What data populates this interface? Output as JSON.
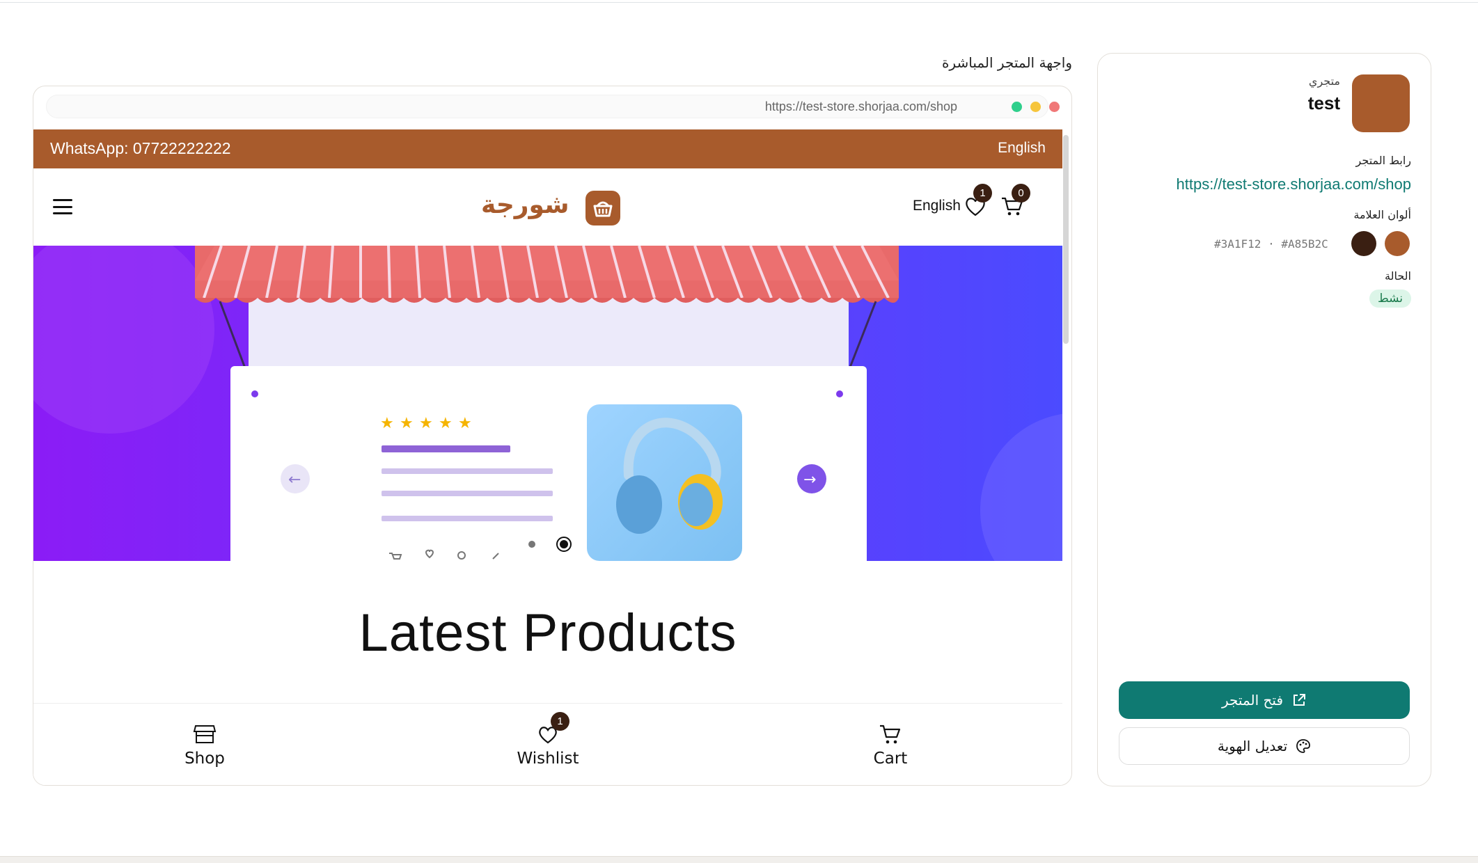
{
  "preview": {
    "title": "واجهة المتجر المباشرة",
    "address_url": "https://test-store.shorjaa.com/shop"
  },
  "site": {
    "promo": {
      "whatsapp": "WhatsApp: 07722222222",
      "language": "English"
    },
    "header": {
      "logo_text": "شورجة",
      "language": "English",
      "wishlist_count": "1",
      "cart_count": "0"
    },
    "hero": {
      "rating_stars": 5,
      "carousel_dots": 2,
      "active_dot": 2
    },
    "section_title": "Latest Products",
    "bottom_nav": [
      {
        "label": "Shop",
        "icon": "store-icon"
      },
      {
        "label": "Wishlist",
        "icon": "heart-icon",
        "badge": "1"
      },
      {
        "label": "Cart",
        "icon": "cart-icon"
      }
    ]
  },
  "store_card": {
    "kicker": "متجري",
    "name": "test",
    "link_label": "رابط المتجر",
    "link_url": "https://test-store.shorjaa.com/shop",
    "colors_label": "ألوان العلامة",
    "colors": [
      "#A85B2C",
      "#3A1F12"
    ],
    "colors_text": "#3A1F12 · #A85B2C",
    "status_label": "الحالة",
    "status_value": "نشط",
    "open_button": "فتح المتجر",
    "edit_button": "تعديل الهوية"
  },
  "theme": {
    "brand": "#a85b2c",
    "dark": "#3a1f12",
    "accent": "#0f7a72"
  }
}
